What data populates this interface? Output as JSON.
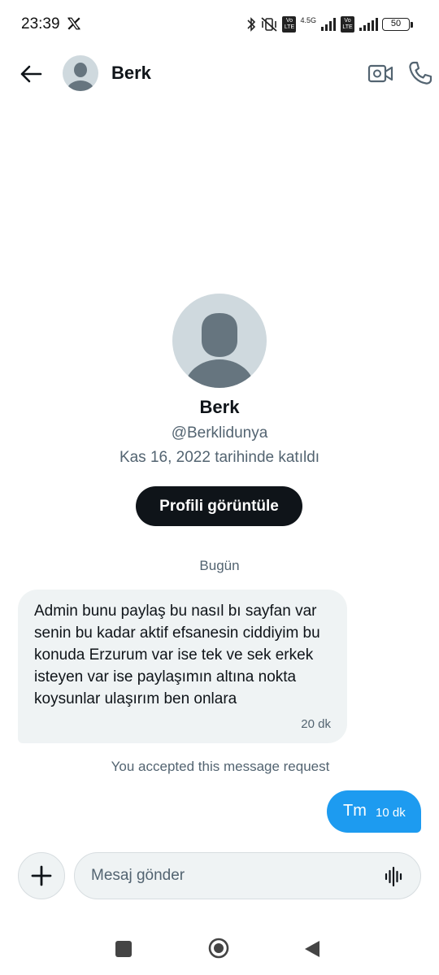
{
  "status_bar": {
    "time": "23:39",
    "network_label": "4.5G",
    "volte_1": "Vo LTE",
    "volte_2": "Vo LTE",
    "battery": "50",
    "icons": [
      "x-logo-icon",
      "bluetooth-icon",
      "mute-vibrate-icon",
      "signal-icon",
      "battery-icon"
    ]
  },
  "header": {
    "name": "Berk",
    "icons": [
      "back-arrow-icon",
      "video-call-icon",
      "phone-icon"
    ]
  },
  "profile": {
    "name": "Berk",
    "handle": "@Berklidunya",
    "joined": "Kas 16, 2022 tarihinde katıldı",
    "view_profile_label": "Profili görüntüle"
  },
  "conversation": {
    "day_label": "Bugün",
    "received": {
      "text": "Admin bunu paylaş bu nasıl bı sayfan var senin bu kadar aktif efsanesin ciddiyim bu konuda Erzurum var ise tek ve sek erkek isteyen var ise paylaşımın altına nokta koysunlar ulaşırım ben onlara",
      "time": "20 dk"
    },
    "notice": "You accepted this message request",
    "sent": {
      "text": "Tm",
      "time": "10 dk"
    }
  },
  "composer": {
    "placeholder": "Mesaj gönder",
    "icons": [
      "plus-icon",
      "voice-message-icon"
    ]
  },
  "colors": {
    "accent": "#1d9bf0",
    "primary_text": "#0f1419",
    "secondary_text": "#536471",
    "bubble_received": "#eff3f4",
    "button_dark": "#0f1419"
  }
}
